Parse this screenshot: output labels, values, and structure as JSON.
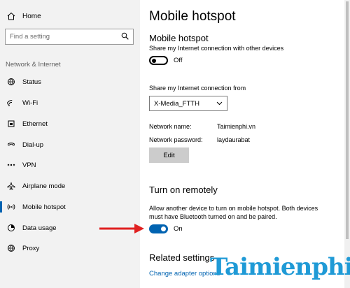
{
  "sidebar": {
    "home_label": "Home",
    "search_placeholder": "Find a setting",
    "section_label": "Network & Internet",
    "items": [
      {
        "label": "Status"
      },
      {
        "label": "Wi-Fi"
      },
      {
        "label": "Ethernet"
      },
      {
        "label": "Dial-up"
      },
      {
        "label": "VPN"
      },
      {
        "label": "Airplane mode"
      },
      {
        "label": "Mobile hotspot",
        "active": true
      },
      {
        "label": "Data usage"
      },
      {
        "label": "Proxy"
      }
    ]
  },
  "main": {
    "page_title": "Mobile hotspot",
    "hotspot": {
      "heading": "Mobile hotspot",
      "description": "Share my Internet connection with other devices",
      "toggle_state": "Off"
    },
    "share_from": {
      "label": "Share my Internet connection from",
      "selected": "X-Media_FTTH"
    },
    "network_name": {
      "key": "Network name:",
      "value": "Taimienphi.vn"
    },
    "network_password": {
      "key": "Network password:",
      "value": "laydaurabat"
    },
    "edit_label": "Edit",
    "remote": {
      "heading": "Turn on remotely",
      "description": "Allow another device to turn on mobile hotspot. Both devices must have Bluetooth turned on and be paired.",
      "toggle_state": "On"
    },
    "related": {
      "heading": "Related settings",
      "link": "Change adapter options"
    }
  },
  "watermark": "Taimienphi",
  "colors": {
    "accent": "#0063b1",
    "sidebar_bg": "#f2f2f2",
    "arrow": "#e02020",
    "watermark": "#1f9ad6"
  }
}
